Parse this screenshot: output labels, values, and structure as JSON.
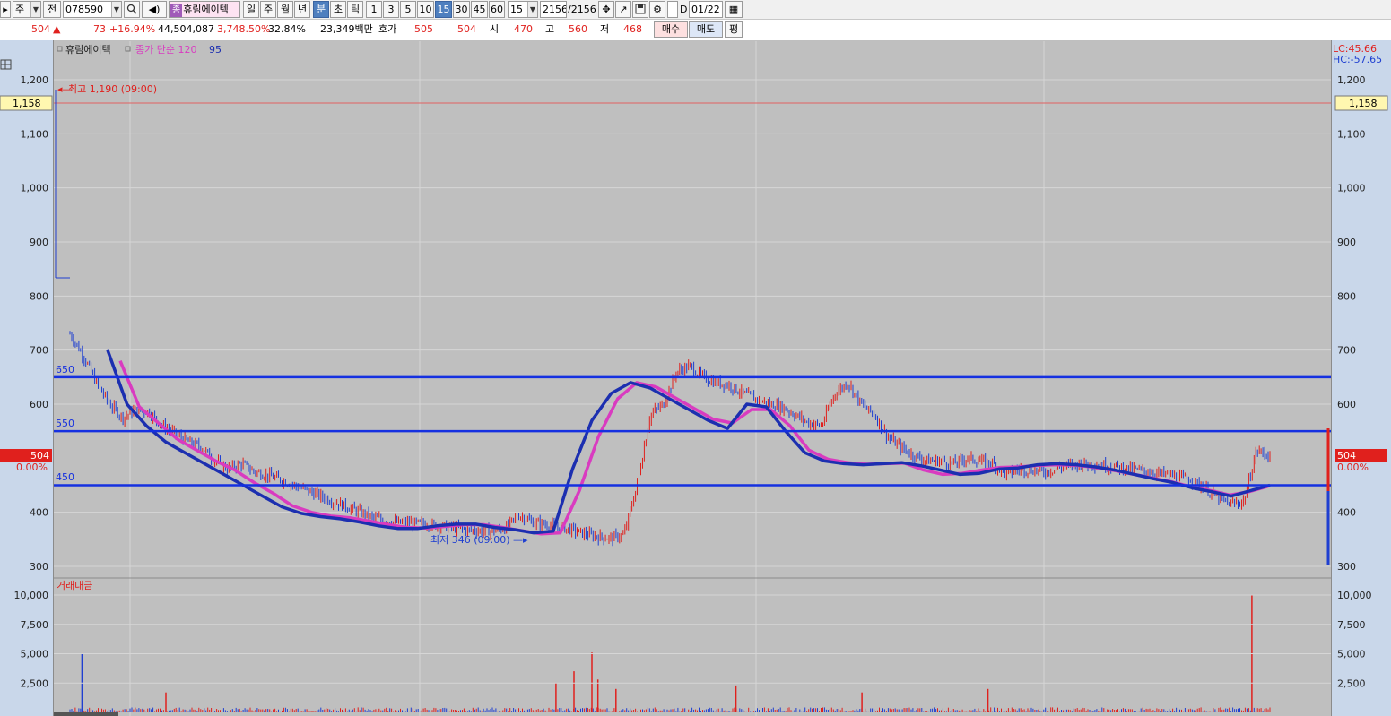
{
  "toolbar": {
    "market": "주",
    "prev_label": "전",
    "code": "078590",
    "stock_badge": "종",
    "stock_name": "휴림에이텍",
    "period_buttons": [
      "일",
      "주",
      "월",
      "년",
      "분",
      "초",
      "틱"
    ],
    "minute_buttons": [
      "1",
      "3",
      "5",
      "10",
      "15",
      "30",
      "45",
      "60"
    ],
    "minute_select": "15",
    "count_value": "2156",
    "count_total": "/2156",
    "date_check": "D",
    "date_value": "01/22"
  },
  "quote": {
    "price": "504",
    "change_arrow": "▲",
    "change": "73",
    "change_pct": "+16.94%",
    "volume": "44,504,087",
    "volume_ratio": "3,748.50%",
    "turnover": "32.84%",
    "amount": "23,349백만",
    "hoga_label": "호가",
    "ask": "505",
    "bid": "504",
    "open_label": "시",
    "open": "470",
    "high_label": "고",
    "high": "560",
    "low_label": "저",
    "low": "468",
    "buy_button": "매수",
    "sell_button": "매도",
    "avg_button": "평"
  },
  "chart": {
    "legend_name": "휴림에이텍",
    "legend_ma": "종가 단순 120",
    "legend_ma2": "95",
    "high_annotation": "최고 1,190 (09:00)",
    "low_annotation": "최저 346 (09:00)",
    "price_ticks": [
      "1,200",
      "1,100",
      "1,000",
      "900",
      "800",
      "700",
      "600",
      "400",
      "300"
    ],
    "level_labels": [
      "650",
      "550",
      "450"
    ],
    "current_tag": "504",
    "current_pct": "0.00%",
    "cursor_tag": "1,158",
    "lc_label": "LC:45.66",
    "hc_label": "HC:-57.65",
    "volume_title": "거래대금",
    "volume_ticks": [
      "10,000",
      "7,500",
      "5,000",
      "2,500"
    ],
    "colors": {
      "up": "#e0201d",
      "down": "#1f3fd1",
      "ma120": "#1c2fb0",
      "ma95": "#d93bc0",
      "hline": "#1530e0"
    }
  },
  "chart_data": {
    "type": "line",
    "price_range": [
      300,
      1200
    ],
    "horizontal_levels": [
      650,
      550,
      450
    ],
    "current_price": 504,
    "cursor_price": 1158,
    "series_close": [
      730,
      690,
      640,
      600,
      575,
      590,
      585,
      560,
      545,
      530,
      520,
      495,
      480,
      490,
      475,
      468,
      460,
      450,
      440,
      430,
      420,
      410,
      400,
      390,
      385,
      380,
      380,
      378,
      375,
      372,
      368,
      366,
      365,
      370,
      395,
      382,
      378,
      373,
      368,
      360,
      355,
      352,
      358,
      450,
      580,
      600,
      660,
      670,
      650,
      640,
      635,
      620,
      610,
      600,
      595,
      580,
      565,
      560,
      620,
      640,
      600,
      580,
      540,
      520,
      505,
      495,
      495,
      490,
      500,
      495,
      490,
      470,
      480,
      478,
      475,
      482,
      488,
      490,
      488,
      485,
      482,
      478,
      474,
      470,
      465,
      460,
      445,
      428,
      415,
      420,
      515,
      504
    ],
    "series_ma120": [
      700,
      600,
      560,
      530,
      510,
      490,
      470,
      450,
      430,
      410,
      398,
      392,
      388,
      382,
      375,
      370,
      370,
      375,
      378,
      378,
      372,
      368,
      362,
      365,
      480,
      570,
      620,
      640,
      630,
      610,
      590,
      570,
      555,
      600,
      595,
      550,
      510,
      495,
      490,
      488,
      490,
      492,
      486,
      478,
      470,
      472,
      480,
      482,
      488,
      490,
      488,
      484,
      478,
      470,
      462,
      455,
      445,
      438,
      430,
      440,
      450
    ],
    "series_ma95": [
      680,
      595,
      565,
      535,
      515,
      495,
      478,
      455,
      435,
      412,
      400,
      393,
      390,
      384,
      377,
      372,
      371,
      374,
      377,
      377,
      372,
      366,
      360,
      362,
      440,
      540,
      610,
      640,
      632,
      612,
      592,
      572,
      565,
      590,
      590,
      560,
      515,
      498,
      492,
      489,
      490,
      491,
      478,
      470,
      472,
      478,
      483,
      484,
      487,
      488,
      487,
      483,
      477,
      470,
      463,
      456,
      447,
      440,
      432,
      438,
      448
    ],
    "volume_range": [
      0,
      10000
    ],
    "volume_spikes": [
      {
        "x": 0.01,
        "v": 5000
      },
      {
        "x": 0.08,
        "v": 1700
      },
      {
        "x": 0.405,
        "v": 2500
      },
      {
        "x": 0.42,
        "v": 3500
      },
      {
        "x": 0.435,
        "v": 5100
      },
      {
        "x": 0.44,
        "v": 2800
      },
      {
        "x": 0.455,
        "v": 2000
      },
      {
        "x": 0.555,
        "v": 2300
      },
      {
        "x": 0.66,
        "v": 1700
      },
      {
        "x": 0.765,
        "v": 2000
      },
      {
        "x": 0.985,
        "v": 10000
      }
    ]
  }
}
